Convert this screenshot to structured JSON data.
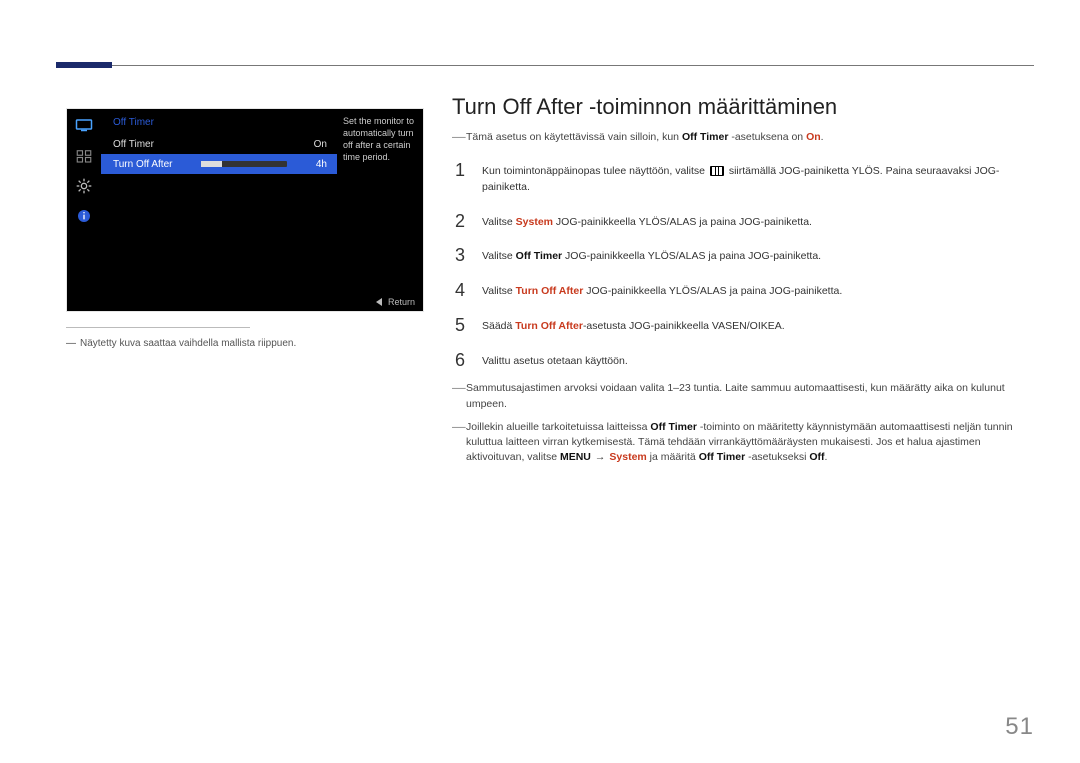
{
  "page_number": "51",
  "screenshot": {
    "menu_title": "Off Timer",
    "rows": [
      {
        "label": "Off Timer",
        "value": "On"
      },
      {
        "label": "Turn Off After",
        "value": "4h"
      }
    ],
    "tooltip": "Set the monitor to automatically turn off after a certain time period.",
    "footer_return": "Return"
  },
  "caption": "Näytetty kuva saattaa vaihdella mallista riippuen.",
  "heading": "Turn Off After -toiminnon määrittäminen",
  "intro_note": {
    "pre": "Tämä asetus on käytettävissä vain silloin, kun ",
    "b1": "Off Timer",
    "mid": " -asetuksena on ",
    "r1": "On",
    "post": "."
  },
  "steps": {
    "s1": {
      "a": "Kun toimintonäppäinopas tulee näyttöön, valitse ",
      "b": " siirtämällä JOG-painiketta YLÖS. Paina seuraavaksi JOG-painiketta."
    },
    "s2": {
      "a": "Valitse ",
      "r": "System",
      "b": " JOG-painikkeella YLÖS/ALAS ja paina JOG-painiketta."
    },
    "s3": {
      "a": "Valitse ",
      "bold": "Off Timer",
      "b": " JOG-painikkeella YLÖS/ALAS ja paina JOG-painiketta."
    },
    "s4": {
      "a": "Valitse ",
      "r": "Turn Off After",
      "b": " JOG-painikkeella YLÖS/ALAS ja paina JOG-painiketta."
    },
    "s5": {
      "a": "Säädä ",
      "r": "Turn Off After",
      "b": "-asetusta JOG-painikkeella VASEN/OIKEA."
    },
    "s6": "Valittu asetus otetaan käyttöön."
  },
  "end_notes": {
    "n1": "Sammutusajastimen arvoksi voidaan valita 1–23 tuntia. Laite sammuu automaattisesti, kun määrätty aika on kulunut umpeen.",
    "n2": {
      "a": "Joillekin alueille tarkoitetuissa laitteissa ",
      "b1": "Off Timer",
      "b": " -toiminto on määritetty käynnistymään automaattisesti neljän tunnin kuluttua laitteen virran kytkemisestä. Tämä tehdään virrankäyttömääräysten mukaisesti. Jos et halua ajastimen aktivoituvan, valitse ",
      "b2": "MENU",
      "arrow": "→",
      "r1": "System",
      "c": " ja määritä ",
      "b3": "Off Timer",
      "d": " -asetukseksi ",
      "b4": "Off",
      "e": "."
    }
  }
}
